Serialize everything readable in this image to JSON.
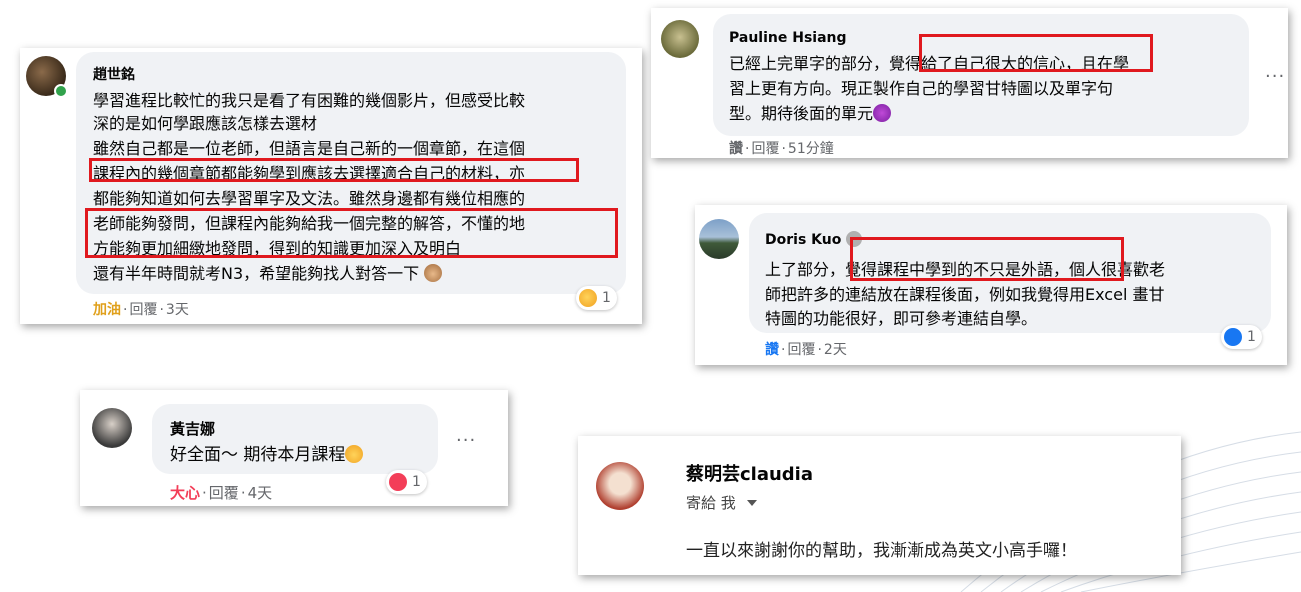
{
  "comments": {
    "c1": {
      "name": "趙世銘",
      "lines": [
        "學習進程比較忙的我只是看了有困難的幾個影片，但感受比較",
        "深的是如何學跟應該怎樣去選材",
        "雖然自己都是一位老師，但語言是自己新的一個章節，在這個",
        "課程內的幾個章節都能夠學到應該去選擇適合自己的材料，亦",
        "都能夠知道如何去學習單字及文法。雖然身邊都有幾位相應的",
        "老師能夠發問，但課程內能夠給我一個完整的解答，不懂的地",
        "方能夠更加細緻地發問，得到的知識更加深入及明白",
        "還有半年時間就考N3，希望能夠找人對答一下"
      ],
      "action_reaction": "加油",
      "action_reply": "回覆",
      "action_time": "3天",
      "reaction_count": "1"
    },
    "c2": {
      "name": "Pauline Hsiang",
      "lines": [
        "已經上完單字的部分，覺得給了自己很大的信心，且在學",
        "習上更有方向。現正製作自己的學習甘特圖以及單字句",
        "型。期待後面的單元"
      ],
      "action_reaction": "讚",
      "action_reply": "回覆",
      "action_time": "51分鐘",
      "more": "···"
    },
    "c3": {
      "name": "Doris Kuo",
      "lines": [
        "上了部分，覺得課程中學到的不只是外語，個人很喜歡老",
        "師把許多的連結放在課程後面，例如我覺得用Excel 畫甘",
        "特圖的功能很好，即可參考連結自學。"
      ],
      "action_reaction": "讚",
      "action_reply": "回覆",
      "action_time": "2天",
      "reaction_count": "1"
    },
    "c4": {
      "name": "黃吉娜",
      "text": "好全面～ 期待本月課程",
      "action_reaction": "大心",
      "action_reply": "回覆",
      "action_time": "4天",
      "reaction_count": "1",
      "more": "···"
    },
    "c5": {
      "name": "蔡明芸claudia",
      "sub": "寄給 我",
      "text": "一直以來謝謝你的幫助，我漸漸成為英文小高手囉！"
    }
  },
  "colors": {
    "highlight_box": "#e0191e",
    "bubble": "#f0f2f5",
    "reaction_text": "#e0a01b",
    "love": "#f33e58",
    "like": "#1877f2",
    "online": "#31a24c"
  },
  "icons": [
    "avatar",
    "online-dot",
    "reaction-emoji",
    "more-icon",
    "heart-icon",
    "like-icon",
    "dropdown-caret-icon"
  ]
}
